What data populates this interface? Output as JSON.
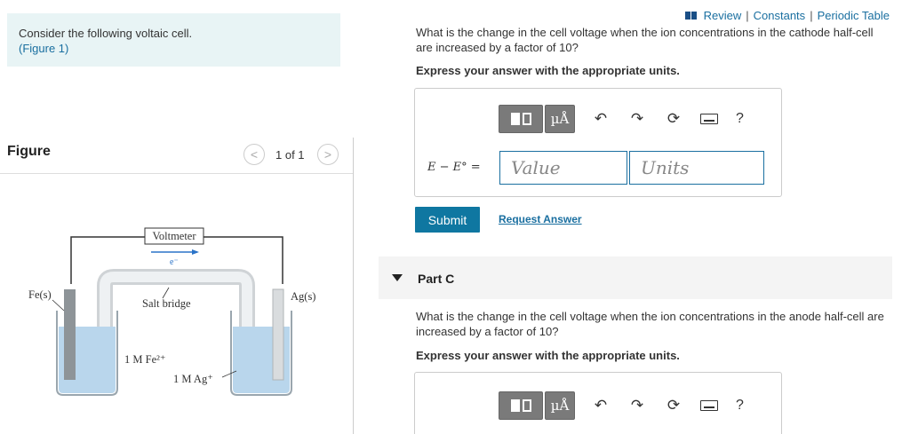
{
  "problem": {
    "text": "Consider the following voltaic cell.",
    "figure_link": "(Figure 1)"
  },
  "figure_panel": {
    "title": "Figure",
    "page_count": "1 of 1",
    "prev_label": "<",
    "next_label": ">"
  },
  "figure": {
    "voltmeter_label": "Voltmeter",
    "electron_label": "e⁻",
    "salt_bridge_label": "Salt bridge",
    "left_electrode_label": "Fe(s)",
    "right_electrode_label": "Ag(s)",
    "left_solution_label": "1 M Fe²⁺",
    "right_solution_label": "1 M Ag⁺"
  },
  "top_links": {
    "review": "Review",
    "constants": "Constants",
    "periodic_table": "Periodic Table",
    "separator": "|"
  },
  "part_b": {
    "question": "What is the change in the cell voltage when the ion concentrations in the cathode half-cell are increased by a factor of 10?",
    "instruction": "Express your answer with the appropriate units.",
    "equation_label": "E − E° =",
    "value_placeholder": "Value",
    "units_placeholder": "Units",
    "submit_label": "Submit",
    "request_answer_label": "Request Answer"
  },
  "part_c": {
    "title": "Part C",
    "question": "What is the change in the cell voltage when the ion concentrations in the anode half-cell are increased by a factor of 10?",
    "instruction": "Express your answer with the appropriate units."
  },
  "toolbar": {
    "units_button_label": "µÅ",
    "undo_icon": "undo-icon",
    "redo_icon": "redo-icon",
    "reset_icon": "reset-icon",
    "keyboard_icon": "keyboard-icon",
    "help_label": "?"
  },
  "colors": {
    "accent": "#0f77a1",
    "link": "#1a6fa0",
    "problem_bg": "#e8f4f5"
  }
}
